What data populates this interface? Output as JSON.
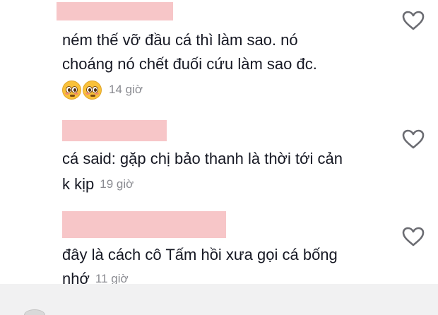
{
  "comments": [
    {
      "text_lines": [
        "ném thế vỡ đầu cá thì làm sao. nó",
        "choáng nó chết đuối cứu làm sao đc."
      ],
      "emojis": [
        "flushed-face-emoji",
        "flushed-face-emoji"
      ],
      "time": "14 giờ"
    },
    {
      "text_lines": [
        "cá said: gặp chị bảo thanh là thời tới cản",
        "k kịp"
      ],
      "time": "19 giờ"
    },
    {
      "text_lines": [
        "đây là cách cô Tấm hồi xưa gọi cá bống",
        "nhớ"
      ],
      "time": "11 giờ"
    }
  ],
  "icons": {
    "like": "heart-outline-icon"
  },
  "colors": {
    "redaction": "#f7c6c8",
    "time": "#8a8b91",
    "text": "#161823"
  }
}
